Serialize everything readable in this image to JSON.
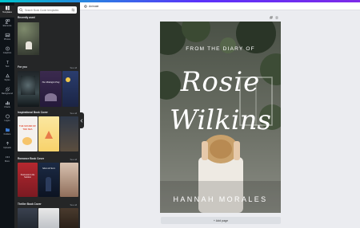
{
  "rail": [
    {
      "label": "Templates",
      "icon": "templates-icon"
    },
    {
      "label": "Elements",
      "icon": "elements-icon"
    },
    {
      "label": "Photos",
      "icon": "photos-icon"
    },
    {
      "label": "Graphics",
      "icon": "graphics-icon"
    },
    {
      "label": "Text",
      "icon": "text-icon"
    },
    {
      "label": "Styles",
      "icon": "styles-icon"
    },
    {
      "label": "Background",
      "icon": "background-icon"
    },
    {
      "label": "Charts",
      "icon": "charts-icon"
    },
    {
      "label": "Logos",
      "icon": "logos-icon"
    },
    {
      "label": "Folders",
      "icon": "folders-icon"
    },
    {
      "label": "Uploads",
      "icon": "uploads-icon"
    },
    {
      "label": "More",
      "icon": "more-icon"
    }
  ],
  "search": {
    "placeholder": "Search Book Cover templates"
  },
  "sections": {
    "recent": {
      "title": "Recently used"
    },
    "for_you": {
      "title": "For you",
      "see_all": "See all"
    },
    "inspirational": {
      "title": "Inspirational Book Cover",
      "see_all": "See all"
    },
    "romance": {
      "title": "Romance Book Cover",
      "see_all": "See all"
    },
    "thriller": {
      "title": "Thriller Book Cover",
      "see_all": "See all"
    }
  },
  "thumbs": {
    "for_you_1": "The Midnight Play",
    "inspirational_1": "THE SOUND OF THE SEA",
    "romance_1": "Passionate in the Summer",
    "romance_2": "Moon & Stars"
  },
  "editor": {
    "doc_label": "Animate"
  },
  "cover": {
    "tagline": "FROM THE DIARY OF",
    "first_name": "Rosie",
    "last_name": "Wilkins",
    "author": "HANNAH MORALES"
  },
  "add_page_label": "+ Add page",
  "colors": {
    "rail_bg": "#0e1318",
    "panel_bg": "#252627",
    "canvas_bg": "#ebecf0",
    "accent": "#7d2ae8"
  }
}
